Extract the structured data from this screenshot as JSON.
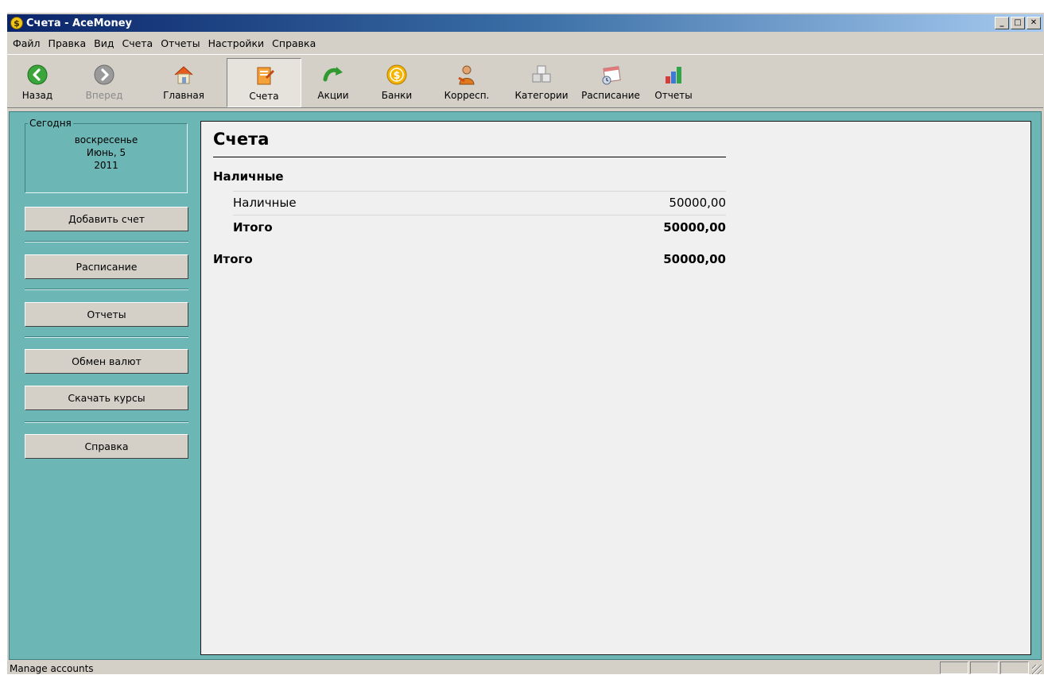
{
  "window": {
    "title": "Счета - AceMoney",
    "app_icon": "dollar-coin-icon"
  },
  "menu": [
    "Файл",
    "Правка",
    "Вид",
    "Счета",
    "Отчеты",
    "Настройки",
    "Справка"
  ],
  "toolbar": [
    {
      "label": "Назад",
      "icon": "back-arrow-icon",
      "state": "normal"
    },
    {
      "label": "Вперед",
      "icon": "forward-arrow-icon",
      "state": "disabled"
    },
    {
      "label": "Главная",
      "icon": "home-icon",
      "state": "normal"
    },
    {
      "label": "Счета",
      "icon": "accounts-icon",
      "state": "active"
    },
    {
      "label": "Акции",
      "icon": "stocks-arrow-icon",
      "state": "normal"
    },
    {
      "label": "Банки",
      "icon": "bank-coin-icon",
      "state": "normal"
    },
    {
      "label": "Корресп.",
      "icon": "payee-person-icon",
      "state": "normal"
    },
    {
      "label": "Категории",
      "icon": "categories-cubes-icon",
      "state": "normal"
    },
    {
      "label": "Расписание",
      "icon": "schedule-calendar-icon",
      "state": "normal"
    },
    {
      "label": "Отчеты",
      "icon": "reports-chart-icon",
      "state": "normal"
    }
  ],
  "sidebar": {
    "today_label": "Сегодня",
    "weekday": "воскресенье",
    "date": "Июнь, 5",
    "year": "2011",
    "buttons": [
      "Добавить счет",
      "Расписание",
      "Отчеты",
      "Обмен валют",
      "Скачать курсы",
      "Справка"
    ]
  },
  "accounts": {
    "title": "Счета",
    "group": "Наличные",
    "rows": [
      {
        "name": "Наличные",
        "amount": "50000,00"
      }
    ],
    "group_total_label": "Итого",
    "group_total": "50000,00",
    "grand_total_label": "Итого",
    "grand_total": "50000,00"
  },
  "status": {
    "text": "Manage accounts"
  },
  "colors": {
    "panel_teal": "#6cb6b6",
    "titlebar": "#0a246a"
  }
}
